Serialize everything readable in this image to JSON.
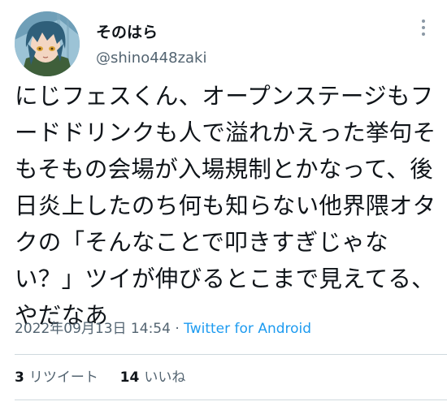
{
  "user": {
    "display_name": "そのはら",
    "handle": "@shino448zaki",
    "avatar_icon": "user-avatar"
  },
  "tweet": {
    "text": "にじフェスくん、オープンステージもフードドリンクも人で溢れかえった挙句そもそもの会場が入場規制とかなって、後日炎上したのち何も知らない他界隈オタクの「そんなことで叩きすぎじゃない？」ツイが伸びるとこまで見えてる、やだなあ"
  },
  "meta": {
    "timestamp": "2022年09月13日 14:54",
    "separator": "·",
    "source": "Twitter for Android"
  },
  "stats": {
    "retweets_count": "3",
    "retweets_label": "リツイート",
    "likes_count": "14",
    "likes_label": "いいね"
  },
  "icons": {
    "more": "more-options-icon"
  },
  "colors": {
    "link": "#1d9bf0",
    "secondary_text": "#536471",
    "divider": "#cfd9de"
  }
}
